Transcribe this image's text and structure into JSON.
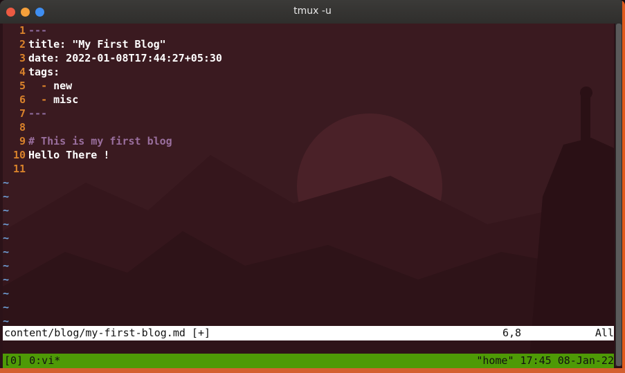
{
  "window": {
    "title": "tmux -u"
  },
  "editor": {
    "lines": [
      {
        "num": "1",
        "text": "---",
        "kind": "dash"
      },
      {
        "num": "2",
        "text": "title: \"My First Blog\"",
        "kind": "normal"
      },
      {
        "num": "3",
        "text": "date: 2022-01-08T17:44:27+05:30",
        "kind": "normal"
      },
      {
        "num": "4",
        "text": "tags:",
        "kind": "normal"
      },
      {
        "num": "5",
        "text": "  - new",
        "kind": "list"
      },
      {
        "num": "6",
        "text": "  - misc",
        "kind": "list"
      },
      {
        "num": "7",
        "text": "---",
        "kind": "dash"
      },
      {
        "num": "8",
        "text": "",
        "kind": "normal"
      },
      {
        "num": "9",
        "text": "# This is my first blog",
        "kind": "heading"
      },
      {
        "num": "10",
        "text": "Hello There !",
        "kind": "normal"
      },
      {
        "num": "11",
        "text": "",
        "kind": "normal"
      }
    ],
    "tilde": "~",
    "tilde_count": 11
  },
  "statusline": {
    "file": "content/blog/my-first-blog.md [+]",
    "position": "6,8",
    "scroll": "All"
  },
  "tmux": {
    "left": "[0] 0:vi*",
    "right": "\"home\" 17:45 08-Jan-22"
  },
  "colors": {
    "line_number": "#d9822b",
    "dash": "#8c6a9a",
    "heading": "#9a6f9e",
    "tilde": "#6f9fd6",
    "tmux_bar": "#4e9a06"
  }
}
